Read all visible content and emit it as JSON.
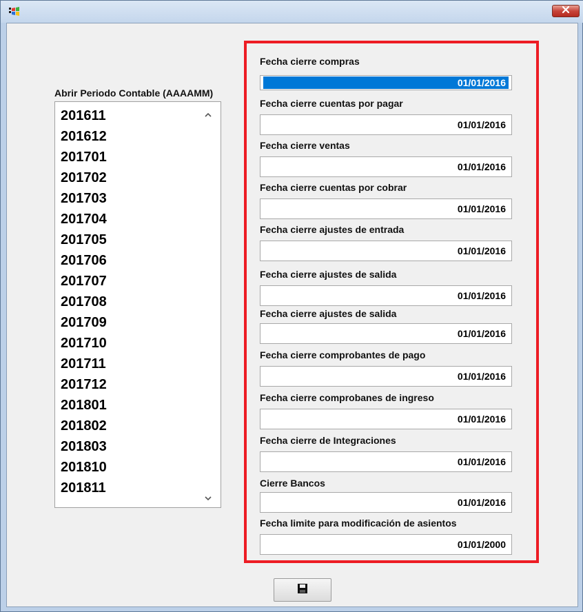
{
  "window": {
    "app_icon": "windows-flag-icon",
    "close_icon": "close-icon"
  },
  "periods": {
    "label": "Abrir Periodo Contable (AAAAMM)",
    "items": [
      "201611",
      "201612",
      "201701",
      "201702",
      "201703",
      "201704",
      "201705",
      "201706",
      "201707",
      "201708",
      "201709",
      "201710",
      "201711",
      "201712",
      "201801",
      "201802",
      "201803",
      "201810",
      "201811"
    ]
  },
  "fields": [
    {
      "label": "Fecha cierre compras",
      "value": "01/01/2016"
    },
    {
      "label": "Fecha cierre cuentas por pagar",
      "value": "01/01/2016"
    },
    {
      "label": "Fecha cierre ventas",
      "value": "01/01/2016"
    },
    {
      "label": "Fecha cierre cuentas por cobrar",
      "value": "01/01/2016"
    },
    {
      "label": "Fecha cierre ajustes de entrada",
      "value": "01/01/2016"
    },
    {
      "label": "Fecha cierre ajustes de salida",
      "value": "01/01/2016"
    },
    {
      "label": "Fecha cierre ajustes de salida",
      "value": "01/01/2016"
    },
    {
      "label": "Fecha cierre comprobantes de pago",
      "value": "01/01/2016"
    },
    {
      "label": "Fecha cierre comprobanes de ingreso",
      "value": "01/01/2016"
    },
    {
      "label": "Fecha cierre de Integraciones",
      "value": "01/01/2016"
    },
    {
      "label": "Cierre Bancos",
      "value": "01/01/2016"
    },
    {
      "label": "Fecha limite para modificación de asientos",
      "value": "01/01/2000"
    }
  ],
  "save": {
    "icon": "floppy-disk-icon"
  },
  "colors": {
    "highlight": "#ed1c24",
    "selection": "#0078d7"
  }
}
